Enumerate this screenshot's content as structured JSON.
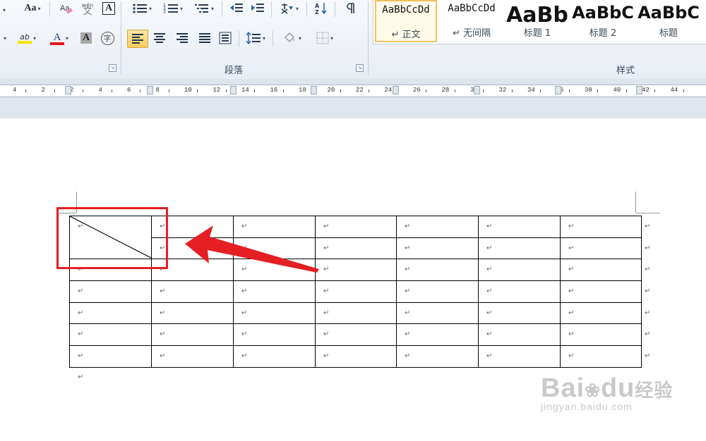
{
  "ribbon": {
    "font_group": {
      "change_case_label": "Aa",
      "phonetic_label": "wén",
      "phonetic_char": "文",
      "char_border_label": "A",
      "font_color_label": "A",
      "char_shading_label": "A",
      "enclose_char_label": "字",
      "highlight_label": "ab"
    },
    "paragraph_group": {
      "label": "段落"
    },
    "styles_group": {
      "label": "样式",
      "items": [
        {
          "sample": "AaBbCcDd",
          "name": "↵ 正文",
          "selected": true
        },
        {
          "sample": "AaBbCcDd",
          "name": "↵ 无间隔",
          "selected": false
        },
        {
          "sample": "AaBb",
          "name": "标题 1",
          "selected": false
        },
        {
          "sample": "AaBbC",
          "name": "标题 2",
          "selected": false
        },
        {
          "sample": "AaBbC",
          "name": "标题",
          "selected": false
        }
      ]
    },
    "colors": {
      "highlight": "#f5e400",
      "font_color": "#e3141b",
      "active_bg": "#f9cc5a"
    }
  },
  "ruler": {
    "numbers": [
      "4",
      "2",
      "2",
      "4",
      "6",
      "8",
      "10",
      "12",
      "14",
      "16",
      "18",
      "20",
      "22",
      "24",
      "26",
      "28",
      "30",
      "32",
      "34",
      "36",
      "38",
      "40",
      "42",
      "44"
    ]
  },
  "document": {
    "paragraph_mark": "↵",
    "table": {
      "rows": 7,
      "cols": 7
    },
    "annotation_color": "#e51f24"
  },
  "watermark": {
    "main": "Bai",
    "du": "du",
    "suffix": "经验",
    "sub": "jingyan.baidu.com"
  }
}
